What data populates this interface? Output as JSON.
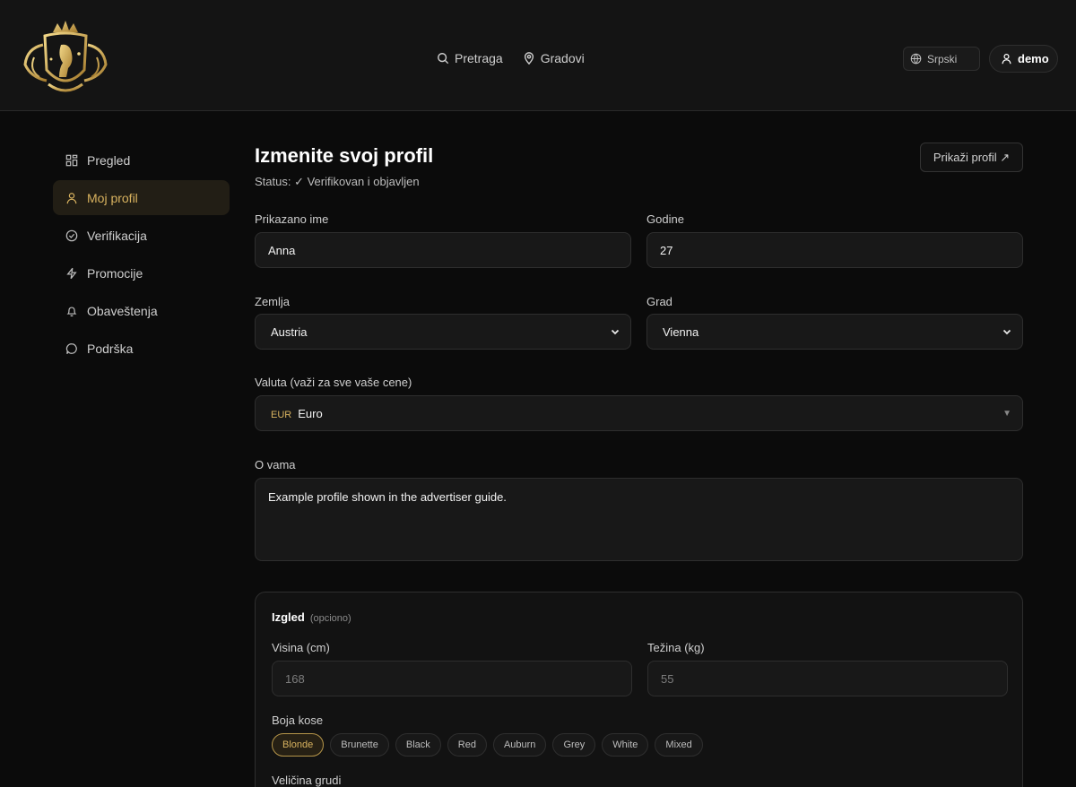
{
  "header": {
    "nav": [
      {
        "label": "Pretraga",
        "icon": "search-icon"
      },
      {
        "label": "Gradovi",
        "icon": "map-pin-icon"
      }
    ],
    "language": "Srpski",
    "user": "demo"
  },
  "sidebar": {
    "items": [
      {
        "label": "Pregled",
        "icon": "grid-icon"
      },
      {
        "label": "Moj profil",
        "icon": "user-icon",
        "active": true
      },
      {
        "label": "Verifikacija",
        "icon": "check-circle-icon"
      },
      {
        "label": "Promocije",
        "icon": "lightning-icon"
      },
      {
        "label": "Obaveštenja",
        "icon": "bell-icon"
      },
      {
        "label": "Podrška",
        "icon": "chat-icon"
      }
    ]
  },
  "main": {
    "title": "Izmenite svoj profil",
    "status": "Status: ✓ Verifikovan i objavljen",
    "show_profile": "Prikaži profil ↗",
    "fields": {
      "display_name": {
        "label": "Prikazano ime",
        "value": "Anna"
      },
      "age": {
        "label": "Godine",
        "value": "27"
      },
      "country": {
        "label": "Zemlja",
        "value": "Austria"
      },
      "city": {
        "label": "Grad",
        "value": "Vienna"
      },
      "currency": {
        "label": "Valuta (važi za sve vaše cene)",
        "code": "EUR",
        "value": "Euro"
      },
      "about": {
        "label": "O vama",
        "value": "Example profile shown in the advertiser guide."
      }
    },
    "appearance": {
      "title": "Izgled",
      "optional": "(opciono)",
      "height": {
        "label": "Visina (cm)",
        "placeholder": "168"
      },
      "weight": {
        "label": "Težina (kg)",
        "placeholder": "55"
      },
      "hair_label": "Boja kose",
      "hair_options": [
        "Blonde",
        "Brunette",
        "Black",
        "Red",
        "Auburn",
        "Grey",
        "White",
        "Mixed"
      ],
      "hair_selected": "Blonde",
      "bust_label": "Veličina grudi"
    }
  },
  "colors": {
    "accent": "#d8b25f",
    "background": "#0b0b0b",
    "panel": "#181818"
  }
}
